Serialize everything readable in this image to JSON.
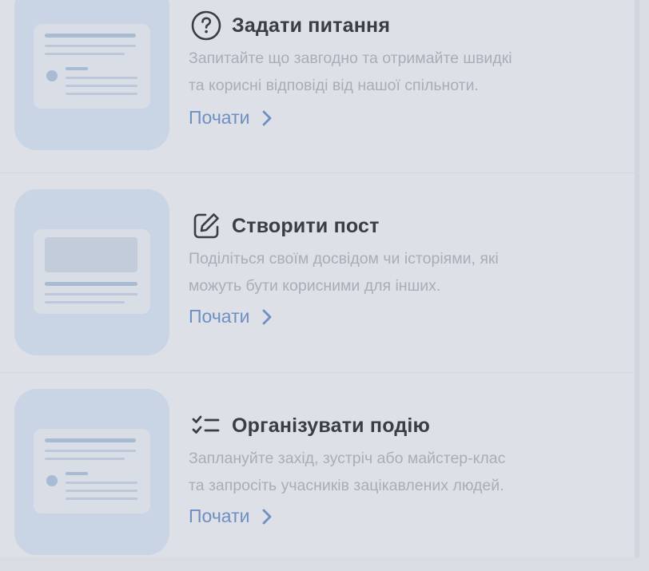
{
  "cards": [
    {
      "title": "Задати питання",
      "icon": "question-circle-icon",
      "description_lines": [
        "Запитайте що завгодно та отримайте швидкі",
        "та корисні відповіді від нашої спільноти."
      ],
      "cta": "Почати"
    },
    {
      "title": "Створити пост",
      "icon": "edit-pencil-icon",
      "description_lines": [
        "Поділіться своїм досвідом чи історіями, які",
        "можуть бути корисними для інших."
      ],
      "cta": "Почати"
    },
    {
      "title": "Організувати подію",
      "icon": "checklist-icon",
      "description_lines": [
        "Заплануйте захід, зустріч або майстер-клас",
        "та запросіть учасників зацікавлених людей."
      ],
      "cta": "Почати"
    }
  ],
  "colors": {
    "overlay_background": "#dde0e7",
    "thumbnail_background": "#c9d4e4",
    "title_text": "#3a3d44",
    "description_text": "#a9adb6",
    "link": "#6f8fc2"
  }
}
